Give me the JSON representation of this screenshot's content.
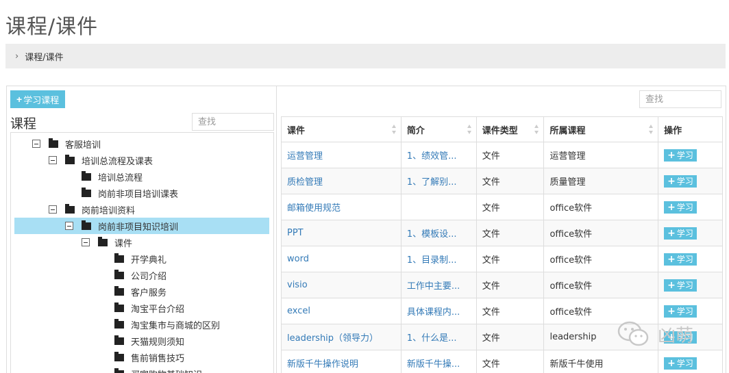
{
  "page": {
    "title": "课程/课件"
  },
  "breadcrumb": {
    "text": "课程/课件"
  },
  "left": {
    "add_button": "学习课程",
    "label": "课程",
    "search_placeholder": "查找",
    "tree": [
      {
        "label": "客服培训",
        "level": 0,
        "toggle": true
      },
      {
        "label": "培训总流程及课表",
        "level": 1,
        "toggle": true
      },
      {
        "label": "培训总流程",
        "level": 2,
        "toggle": false
      },
      {
        "label": "岗前非项目培训课表",
        "level": 2,
        "toggle": false
      },
      {
        "label": "岗前培训资料",
        "level": 1,
        "toggle": true
      },
      {
        "label": "岗前非项目知识培训",
        "level": 2,
        "toggle": true,
        "selected": true
      },
      {
        "label": "课件",
        "level": 3,
        "toggle": true
      },
      {
        "label": "开学典礼",
        "level": 4,
        "toggle": false
      },
      {
        "label": "公司介绍",
        "level": 4,
        "toggle": false
      },
      {
        "label": "客户服务",
        "level": 4,
        "toggle": false
      },
      {
        "label": "淘宝平台介绍",
        "level": 4,
        "toggle": false
      },
      {
        "label": "淘宝集市与商城的区别",
        "level": 4,
        "toggle": false
      },
      {
        "label": "天猫规则须知",
        "level": 4,
        "toggle": false
      },
      {
        "label": "售前销售技巧",
        "level": 4,
        "toggle": false
      },
      {
        "label": "买家购物基础知识",
        "level": 4,
        "toggle": false
      }
    ]
  },
  "right": {
    "search_placeholder": "查找",
    "columns": [
      "课件",
      "简介",
      "课件类型",
      "所属课程",
      "操作"
    ],
    "rows": [
      {
        "name": "运营管理",
        "intro": "1、绩效管...",
        "type": "文件",
        "course": "运营管理",
        "action": "学习"
      },
      {
        "name": "质检管理",
        "intro": "1、了解别...",
        "type": "文件",
        "course": "质量管理",
        "action": "学习"
      },
      {
        "name": "邮箱使用规范",
        "intro": "",
        "type": "文件",
        "course": "office软件",
        "action": "学习"
      },
      {
        "name": "PPT",
        "intro": "1、模板设...",
        "type": "文件",
        "course": "office软件",
        "action": "学习"
      },
      {
        "name": "word",
        "intro": "1、目录制...",
        "type": "文件",
        "course": "office软件",
        "action": "学习"
      },
      {
        "name": "visio",
        "intro": "工作中主要...",
        "type": "文件",
        "course": "office软件",
        "action": "学习"
      },
      {
        "name": "excel",
        "intro": "具体课程内...",
        "type": "文件",
        "course": "office软件",
        "action": "学习"
      },
      {
        "name": "leadership（领导力）",
        "intro": "1、什么是...",
        "type": "文件",
        "course": "leadership",
        "action": "学习"
      },
      {
        "name": "新版千牛操作说明",
        "intro": "新版千牛操...",
        "type": "文件",
        "course": "新版千牛使用",
        "action": "学习"
      }
    ]
  },
  "watermark": {
    "text": "凶萌"
  },
  "colors": {
    "accent": "#5bc0de",
    "link": "#337ab7",
    "selected": "#a8dff4"
  }
}
